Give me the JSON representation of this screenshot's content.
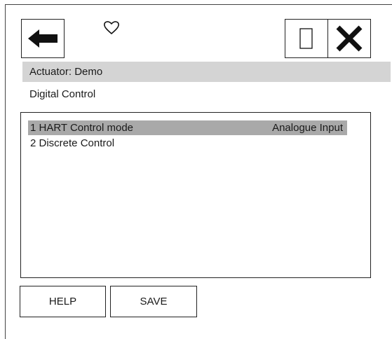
{
  "toolbar": {
    "back_icon": "left-arrow-icon",
    "favorite_icon": "heart-outline-icon",
    "window_icon": "window-icon",
    "close_icon": "close-x-icon"
  },
  "header": {
    "actuator_label": "Actuator: Demo",
    "page_title": "Digital Control"
  },
  "menu": {
    "items": [
      {
        "label": "1 HART Control mode",
        "value": "Analogue Input",
        "selected": true
      },
      {
        "label": "2 Discrete Control",
        "value": "",
        "selected": false
      }
    ]
  },
  "footer": {
    "help_label": "HELP",
    "save_label": "SAVE"
  },
  "colors": {
    "header_band": "#d4d4d4",
    "selected_row": "#a9a9a9",
    "border": "#222222"
  }
}
